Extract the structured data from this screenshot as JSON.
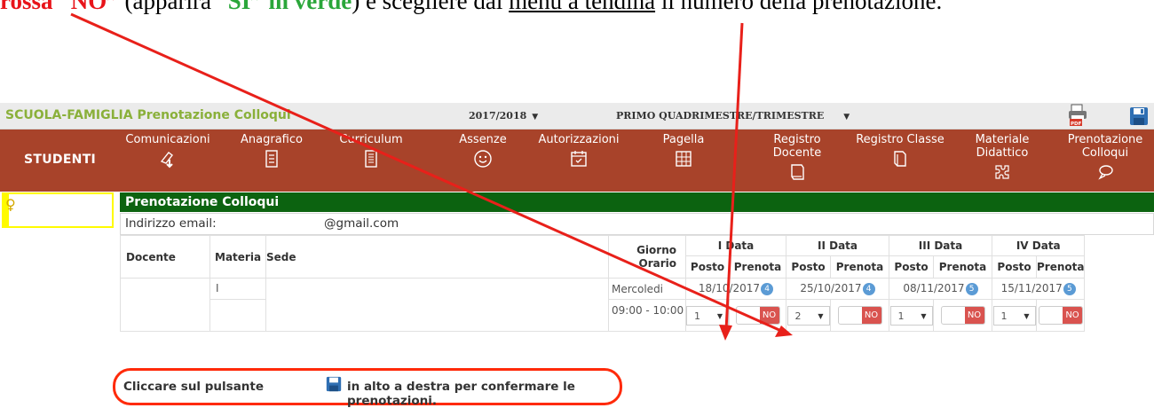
{
  "doc": {
    "t1": "rossa “NO”",
    "t2": " (apparirà “",
    "t3": "SI” in verde",
    "t4": ") e scegliere dal ",
    "t5": "menu a tendina",
    "t6": " il numero della prenotazione."
  },
  "topbar": {
    "brand1": "SCUOLA-FAMIGLIA",
    "brand2": "Prenotazione Colloqui",
    "year": "2017/2018",
    "period": "PRIMO QUADRIMESTRE/TRIMESTRE"
  },
  "nav": {
    "students": "STUDENTI",
    "items": [
      {
        "l1": "Comunicazioni",
        "l2": "",
        "icon": "paper-download-icon"
      },
      {
        "l1": "Anagrafico",
        "l2": "",
        "icon": "document-icon"
      },
      {
        "l1": "Curriculum",
        "l2": "",
        "icon": "document-list-icon"
      },
      {
        "l1": "Assenze",
        "l2": "",
        "icon": "smiley-icon"
      },
      {
        "l1": "Autorizzazioni",
        "l2": "",
        "icon": "calendar-check-icon"
      },
      {
        "l1": "Pagella",
        "l2": "",
        "icon": "report-card-icon"
      },
      {
        "l1": "Registro",
        "l2": "Docente",
        "icon": "book-icon"
      },
      {
        "l1": "Registro Classe",
        "l2": "",
        "icon": "register-book-icon"
      },
      {
        "l1": "Materiale",
        "l2": "Didattico",
        "icon": "puzzle-icon"
      },
      {
        "l1": "Prenotazione",
        "l2": "Colloqui",
        "icon": "chat-icon"
      }
    ]
  },
  "section": {
    "title": "Prenotazione Colloqui",
    "email_label": "Indirizzo email:",
    "email_value": "@gmail.com"
  },
  "table": {
    "h_docente": "Docente",
    "h_materia": "Materia",
    "h_sede": "Sede",
    "h_giorno1": "Giorno",
    "h_giorno2": "Orario",
    "h_posto": "Posto",
    "h_prenota": "Prenota",
    "dates": [
      {
        "label": "I Data",
        "date": "18/10/2017",
        "count": "4",
        "seat": "1",
        "booked": "NO"
      },
      {
        "label": "II Data",
        "date": "25/10/2017",
        "count": "4",
        "seat": "2",
        "booked": "NO"
      },
      {
        "label": "III Data",
        "date": "08/11/2017",
        "count": "5",
        "seat": "1",
        "booked": "NO"
      },
      {
        "label": "IV Data",
        "date": "15/11/2017",
        "count": "5",
        "seat": "1",
        "booked": "NO"
      }
    ],
    "row": {
      "materia": "I",
      "day": "Mercoledi",
      "time": "09:00 - 10:00"
    }
  },
  "hint": {
    "t1": "Cliccare sul pulsante",
    "t2": "in alto a destra per confermare le prenotazioni."
  },
  "colors": {
    "nav": "#a8432a",
    "section": "#0c6310",
    "annotation": "#ff2a0a",
    "no_button": "#d9534f",
    "badge": "#5b9bd5"
  }
}
